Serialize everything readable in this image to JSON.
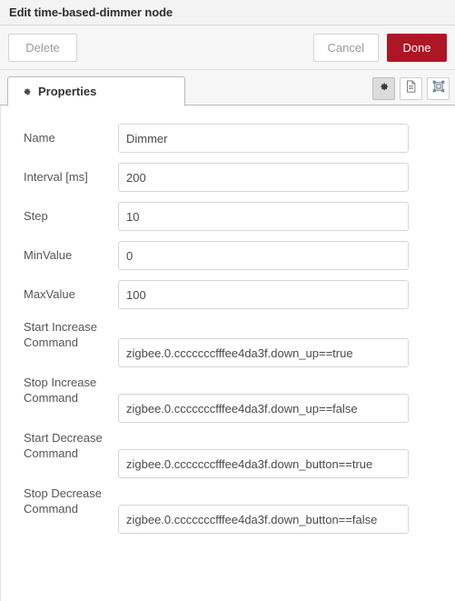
{
  "window": {
    "title": "Edit time-based-dimmer node"
  },
  "toolbar": {
    "delete_label": "Delete",
    "cancel_label": "Cancel",
    "done_label": "Done",
    "done_color": "#ad1625"
  },
  "tabs": [
    {
      "label": "Properties",
      "icon": "gear-icon",
      "active": true
    }
  ],
  "tab_icons": [
    {
      "name": "gear-icon",
      "active": true
    },
    {
      "name": "document-icon",
      "active": false
    },
    {
      "name": "resize-node-icon",
      "active": false
    }
  ],
  "form": {
    "fields": [
      {
        "label": "Name",
        "value": "Dimmer",
        "two_line": false
      },
      {
        "label": "Interval [ms]",
        "value": "200",
        "two_line": false
      },
      {
        "label": "Step",
        "value": "10",
        "two_line": false
      },
      {
        "label": "MinValue",
        "value": "0",
        "two_line": false
      },
      {
        "label": "MaxValue",
        "value": "100",
        "two_line": false
      },
      {
        "label": "Start Increase Command",
        "value": "zigbee.0.cccccccfffee4da3f.down_up==true",
        "two_line": true
      },
      {
        "label": "Stop Increase Command",
        "value": "zigbee.0.cccccccfffee4da3f.down_up==false",
        "two_line": true
      },
      {
        "label": "Start Decrease Command",
        "value": "zigbee.0.cccccccfffee4da3f.down_button==true",
        "two_line": true
      },
      {
        "label": "Stop Decrease Command",
        "value": "zigbee.0.cccccccfffee4da3f.down_button==false",
        "two_line": true
      }
    ]
  }
}
